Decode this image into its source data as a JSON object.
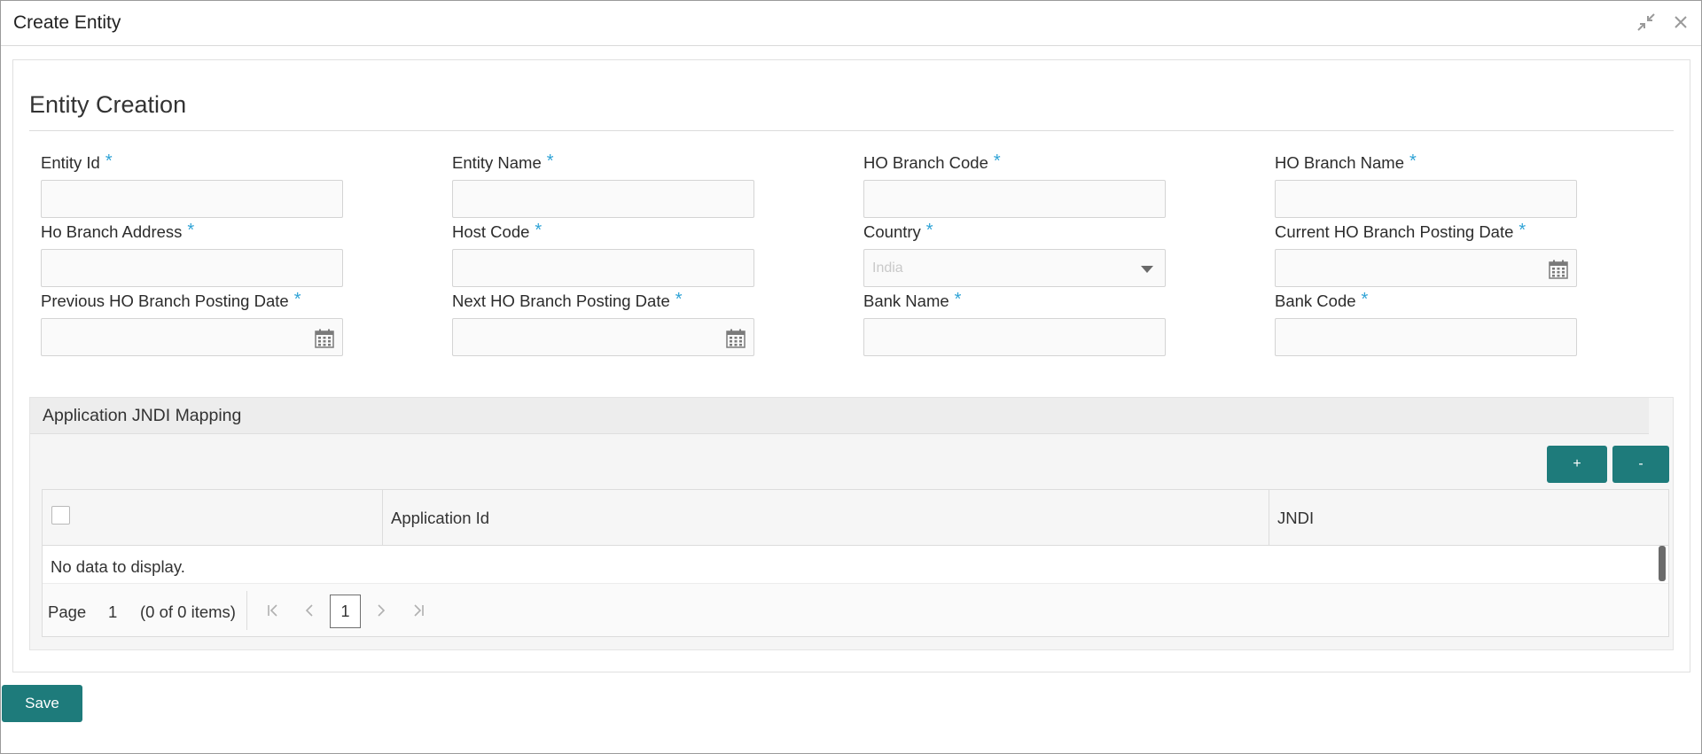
{
  "window": {
    "title": "Create Entity"
  },
  "form": {
    "section_title": "Entity Creation",
    "required_mark": "*",
    "fields": [
      {
        "label": "Entity Id",
        "value": ""
      },
      {
        "label": "Entity Name",
        "value": ""
      },
      {
        "label": "HO Branch Code",
        "value": ""
      },
      {
        "label": "HO Branch Name",
        "value": ""
      },
      {
        "label": "Ho Branch Address",
        "value": ""
      },
      {
        "label": "Host Code",
        "value": ""
      },
      {
        "label": "Country",
        "value": "India"
      },
      {
        "label": "Current HO Branch Posting Date",
        "value": ""
      },
      {
        "label": "Previous HO Branch Posting Date",
        "value": ""
      },
      {
        "label": "Next HO Branch Posting Date",
        "value": ""
      },
      {
        "label": "Bank Name",
        "value": ""
      },
      {
        "label": "Bank Code",
        "value": ""
      }
    ]
  },
  "jndi": {
    "title": "Application JNDI Mapping",
    "add_label": "+",
    "remove_label": "-",
    "columns": [
      "Application Id",
      "JNDI"
    ],
    "empty_text": "No data to display.",
    "pager": {
      "page_label": "Page",
      "page_number": "1",
      "items_text": "(0 of 0 items)",
      "current_page": "1"
    }
  },
  "footer": {
    "save_label": "Save"
  },
  "colors": {
    "accent": "#1e7b7b",
    "required": "#2fa3d6"
  }
}
